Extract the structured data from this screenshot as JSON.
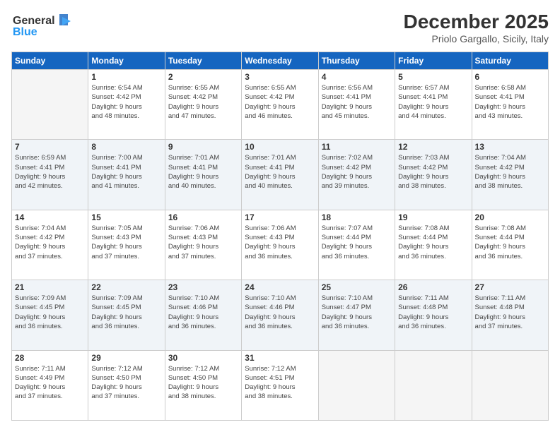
{
  "header": {
    "logo_line1": "General",
    "logo_line2": "Blue",
    "month": "December 2025",
    "location": "Priolo Gargallo, Sicily, Italy"
  },
  "weekdays": [
    "Sunday",
    "Monday",
    "Tuesday",
    "Wednesday",
    "Thursday",
    "Friday",
    "Saturday"
  ],
  "weeks": [
    [
      {
        "num": "",
        "sunrise": "",
        "sunset": "",
        "daylight": ""
      },
      {
        "num": "1",
        "sunrise": "Sunrise: 6:54 AM",
        "sunset": "Sunset: 4:42 PM",
        "daylight": "Daylight: 9 hours and 48 minutes."
      },
      {
        "num": "2",
        "sunrise": "Sunrise: 6:55 AM",
        "sunset": "Sunset: 4:42 PM",
        "daylight": "Daylight: 9 hours and 47 minutes."
      },
      {
        "num": "3",
        "sunrise": "Sunrise: 6:55 AM",
        "sunset": "Sunset: 4:42 PM",
        "daylight": "Daylight: 9 hours and 46 minutes."
      },
      {
        "num": "4",
        "sunrise": "Sunrise: 6:56 AM",
        "sunset": "Sunset: 4:41 PM",
        "daylight": "Daylight: 9 hours and 45 minutes."
      },
      {
        "num": "5",
        "sunrise": "Sunrise: 6:57 AM",
        "sunset": "Sunset: 4:41 PM",
        "daylight": "Daylight: 9 hours and 44 minutes."
      },
      {
        "num": "6",
        "sunrise": "Sunrise: 6:58 AM",
        "sunset": "Sunset: 4:41 PM",
        "daylight": "Daylight: 9 hours and 43 minutes."
      }
    ],
    [
      {
        "num": "7",
        "sunrise": "Sunrise: 6:59 AM",
        "sunset": "Sunset: 4:41 PM",
        "daylight": "Daylight: 9 hours and 42 minutes."
      },
      {
        "num": "8",
        "sunrise": "Sunrise: 7:00 AM",
        "sunset": "Sunset: 4:41 PM",
        "daylight": "Daylight: 9 hours and 41 minutes."
      },
      {
        "num": "9",
        "sunrise": "Sunrise: 7:01 AM",
        "sunset": "Sunset: 4:41 PM",
        "daylight": "Daylight: 9 hours and 40 minutes."
      },
      {
        "num": "10",
        "sunrise": "Sunrise: 7:01 AM",
        "sunset": "Sunset: 4:41 PM",
        "daylight": "Daylight: 9 hours and 40 minutes."
      },
      {
        "num": "11",
        "sunrise": "Sunrise: 7:02 AM",
        "sunset": "Sunset: 4:42 PM",
        "daylight": "Daylight: 9 hours and 39 minutes."
      },
      {
        "num": "12",
        "sunrise": "Sunrise: 7:03 AM",
        "sunset": "Sunset: 4:42 PM",
        "daylight": "Daylight: 9 hours and 38 minutes."
      },
      {
        "num": "13",
        "sunrise": "Sunrise: 7:04 AM",
        "sunset": "Sunset: 4:42 PM",
        "daylight": "Daylight: 9 hours and 38 minutes."
      }
    ],
    [
      {
        "num": "14",
        "sunrise": "Sunrise: 7:04 AM",
        "sunset": "Sunset: 4:42 PM",
        "daylight": "Daylight: 9 hours and 37 minutes."
      },
      {
        "num": "15",
        "sunrise": "Sunrise: 7:05 AM",
        "sunset": "Sunset: 4:43 PM",
        "daylight": "Daylight: 9 hours and 37 minutes."
      },
      {
        "num": "16",
        "sunrise": "Sunrise: 7:06 AM",
        "sunset": "Sunset: 4:43 PM",
        "daylight": "Daylight: 9 hours and 37 minutes."
      },
      {
        "num": "17",
        "sunrise": "Sunrise: 7:06 AM",
        "sunset": "Sunset: 4:43 PM",
        "daylight": "Daylight: 9 hours and 36 minutes."
      },
      {
        "num": "18",
        "sunrise": "Sunrise: 7:07 AM",
        "sunset": "Sunset: 4:44 PM",
        "daylight": "Daylight: 9 hours and 36 minutes."
      },
      {
        "num": "19",
        "sunrise": "Sunrise: 7:08 AM",
        "sunset": "Sunset: 4:44 PM",
        "daylight": "Daylight: 9 hours and 36 minutes."
      },
      {
        "num": "20",
        "sunrise": "Sunrise: 7:08 AM",
        "sunset": "Sunset: 4:44 PM",
        "daylight": "Daylight: 9 hours and 36 minutes."
      }
    ],
    [
      {
        "num": "21",
        "sunrise": "Sunrise: 7:09 AM",
        "sunset": "Sunset: 4:45 PM",
        "daylight": "Daylight: 9 hours and 36 minutes."
      },
      {
        "num": "22",
        "sunrise": "Sunrise: 7:09 AM",
        "sunset": "Sunset: 4:45 PM",
        "daylight": "Daylight: 9 hours and 36 minutes."
      },
      {
        "num": "23",
        "sunrise": "Sunrise: 7:10 AM",
        "sunset": "Sunset: 4:46 PM",
        "daylight": "Daylight: 9 hours and 36 minutes."
      },
      {
        "num": "24",
        "sunrise": "Sunrise: 7:10 AM",
        "sunset": "Sunset: 4:46 PM",
        "daylight": "Daylight: 9 hours and 36 minutes."
      },
      {
        "num": "25",
        "sunrise": "Sunrise: 7:10 AM",
        "sunset": "Sunset: 4:47 PM",
        "daylight": "Daylight: 9 hours and 36 minutes."
      },
      {
        "num": "26",
        "sunrise": "Sunrise: 7:11 AM",
        "sunset": "Sunset: 4:48 PM",
        "daylight": "Daylight: 9 hours and 36 minutes."
      },
      {
        "num": "27",
        "sunrise": "Sunrise: 7:11 AM",
        "sunset": "Sunset: 4:48 PM",
        "daylight": "Daylight: 9 hours and 37 minutes."
      }
    ],
    [
      {
        "num": "28",
        "sunrise": "Sunrise: 7:11 AM",
        "sunset": "Sunset: 4:49 PM",
        "daylight": "Daylight: 9 hours and 37 minutes."
      },
      {
        "num": "29",
        "sunrise": "Sunrise: 7:12 AM",
        "sunset": "Sunset: 4:50 PM",
        "daylight": "Daylight: 9 hours and 37 minutes."
      },
      {
        "num": "30",
        "sunrise": "Sunrise: 7:12 AM",
        "sunset": "Sunset: 4:50 PM",
        "daylight": "Daylight: 9 hours and 38 minutes."
      },
      {
        "num": "31",
        "sunrise": "Sunrise: 7:12 AM",
        "sunset": "Sunset: 4:51 PM",
        "daylight": "Daylight: 9 hours and 38 minutes."
      },
      {
        "num": "",
        "sunrise": "",
        "sunset": "",
        "daylight": ""
      },
      {
        "num": "",
        "sunrise": "",
        "sunset": "",
        "daylight": ""
      },
      {
        "num": "",
        "sunrise": "",
        "sunset": "",
        "daylight": ""
      }
    ]
  ]
}
